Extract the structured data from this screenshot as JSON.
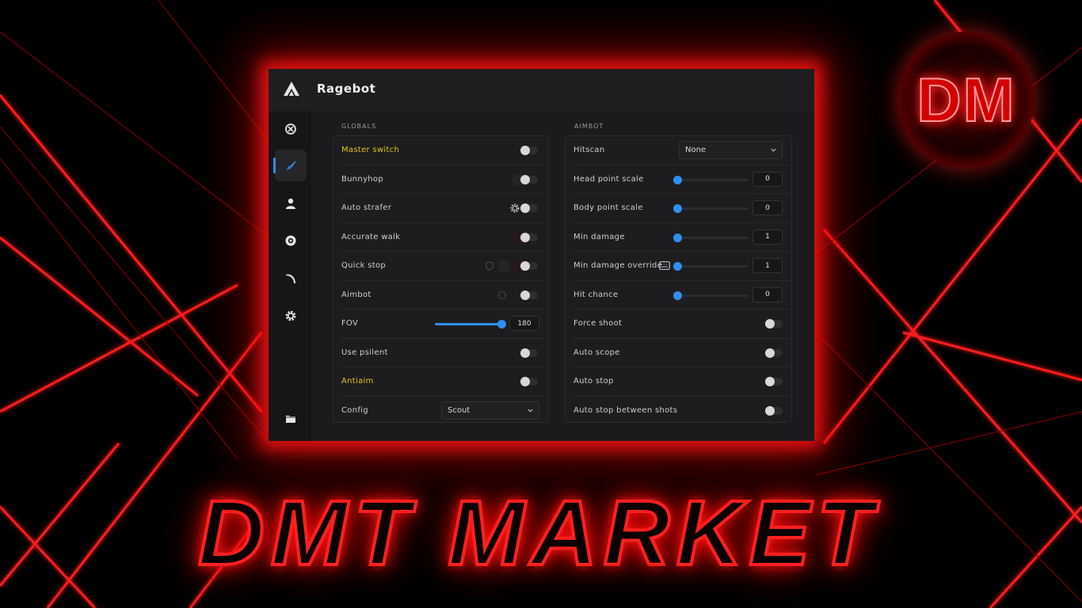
{
  "window": {
    "title": "Ragebot"
  },
  "branding": {
    "badge_text": "DM",
    "footer_text": "DMT MARKET"
  },
  "sidebar": {
    "items": [
      {
        "icon": "crosshair-icon",
        "active": false
      },
      {
        "icon": "knife-icon",
        "active": true
      },
      {
        "icon": "user-icon",
        "active": false
      },
      {
        "icon": "eye-icon",
        "active": false
      },
      {
        "icon": "scythe-icon",
        "active": false
      },
      {
        "icon": "gear-icon",
        "active": false
      }
    ],
    "bottom_icon": "folder-icon"
  },
  "globals": {
    "section_label": "GLOBALS",
    "rows": {
      "master_switch": {
        "label": "Master switch"
      },
      "bunnyhop": {
        "label": "Bunnyhop"
      },
      "auto_strafer": {
        "label": "Auto strafer"
      },
      "accurate_walk": {
        "label": "Accurate walk"
      },
      "quick_stop": {
        "label": "Quick stop"
      },
      "aimbot": {
        "label": "Aimbot"
      },
      "fov": {
        "label": "FOV",
        "value": "180",
        "fraction": 1.0
      },
      "use_psilent": {
        "label": "Use psilent"
      },
      "antiaim": {
        "label": "Antiaim"
      },
      "config": {
        "label": "Config",
        "selected": "Scout"
      }
    }
  },
  "aimbot": {
    "section_label": "AIMBOT",
    "rows": {
      "hitscan": {
        "label": "Hitscan",
        "selected": "None"
      },
      "head_point_scale": {
        "label": "Head point scale",
        "value": "0"
      },
      "body_point_scale": {
        "label": "Body point scale",
        "value": "0"
      },
      "min_damage": {
        "label": "Min damage",
        "value": "1"
      },
      "min_damage_override": {
        "label": "Min damage override",
        "value": "1"
      },
      "hit_chance": {
        "label": "Hit chance",
        "value": "0"
      },
      "force_shoot": {
        "label": "Force shoot"
      },
      "auto_scope": {
        "label": "Auto scope"
      },
      "auto_stop": {
        "label": "Auto stop"
      },
      "auto_stop_between_shots": {
        "label": "Auto stop between shots"
      }
    }
  },
  "colors": {
    "accent": "#2f8ff0",
    "highlight_label": "#e3c21a",
    "glow": "#ff1a1a"
  }
}
